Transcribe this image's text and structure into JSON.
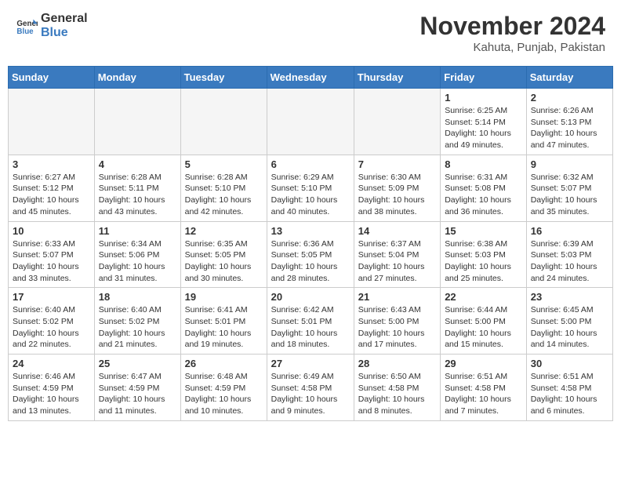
{
  "header": {
    "logo_line1": "General",
    "logo_line2": "Blue",
    "month_title": "November 2024",
    "location": "Kahuta, Punjab, Pakistan"
  },
  "days_of_week": [
    "Sunday",
    "Monday",
    "Tuesday",
    "Wednesday",
    "Thursday",
    "Friday",
    "Saturday"
  ],
  "weeks": [
    [
      {
        "day": "",
        "info": ""
      },
      {
        "day": "",
        "info": ""
      },
      {
        "day": "",
        "info": ""
      },
      {
        "day": "",
        "info": ""
      },
      {
        "day": "",
        "info": ""
      },
      {
        "day": "1",
        "info": "Sunrise: 6:25 AM\nSunset: 5:14 PM\nDaylight: 10 hours and 49 minutes."
      },
      {
        "day": "2",
        "info": "Sunrise: 6:26 AM\nSunset: 5:13 PM\nDaylight: 10 hours and 47 minutes."
      }
    ],
    [
      {
        "day": "3",
        "info": "Sunrise: 6:27 AM\nSunset: 5:12 PM\nDaylight: 10 hours and 45 minutes."
      },
      {
        "day": "4",
        "info": "Sunrise: 6:28 AM\nSunset: 5:11 PM\nDaylight: 10 hours and 43 minutes."
      },
      {
        "day": "5",
        "info": "Sunrise: 6:28 AM\nSunset: 5:10 PM\nDaylight: 10 hours and 42 minutes."
      },
      {
        "day": "6",
        "info": "Sunrise: 6:29 AM\nSunset: 5:10 PM\nDaylight: 10 hours and 40 minutes."
      },
      {
        "day": "7",
        "info": "Sunrise: 6:30 AM\nSunset: 5:09 PM\nDaylight: 10 hours and 38 minutes."
      },
      {
        "day": "8",
        "info": "Sunrise: 6:31 AM\nSunset: 5:08 PM\nDaylight: 10 hours and 36 minutes."
      },
      {
        "day": "9",
        "info": "Sunrise: 6:32 AM\nSunset: 5:07 PM\nDaylight: 10 hours and 35 minutes."
      }
    ],
    [
      {
        "day": "10",
        "info": "Sunrise: 6:33 AM\nSunset: 5:07 PM\nDaylight: 10 hours and 33 minutes."
      },
      {
        "day": "11",
        "info": "Sunrise: 6:34 AM\nSunset: 5:06 PM\nDaylight: 10 hours and 31 minutes."
      },
      {
        "day": "12",
        "info": "Sunrise: 6:35 AM\nSunset: 5:05 PM\nDaylight: 10 hours and 30 minutes."
      },
      {
        "day": "13",
        "info": "Sunrise: 6:36 AM\nSunset: 5:05 PM\nDaylight: 10 hours and 28 minutes."
      },
      {
        "day": "14",
        "info": "Sunrise: 6:37 AM\nSunset: 5:04 PM\nDaylight: 10 hours and 27 minutes."
      },
      {
        "day": "15",
        "info": "Sunrise: 6:38 AM\nSunset: 5:03 PM\nDaylight: 10 hours and 25 minutes."
      },
      {
        "day": "16",
        "info": "Sunrise: 6:39 AM\nSunset: 5:03 PM\nDaylight: 10 hours and 24 minutes."
      }
    ],
    [
      {
        "day": "17",
        "info": "Sunrise: 6:40 AM\nSunset: 5:02 PM\nDaylight: 10 hours and 22 minutes."
      },
      {
        "day": "18",
        "info": "Sunrise: 6:40 AM\nSunset: 5:02 PM\nDaylight: 10 hours and 21 minutes."
      },
      {
        "day": "19",
        "info": "Sunrise: 6:41 AM\nSunset: 5:01 PM\nDaylight: 10 hours and 19 minutes."
      },
      {
        "day": "20",
        "info": "Sunrise: 6:42 AM\nSunset: 5:01 PM\nDaylight: 10 hours and 18 minutes."
      },
      {
        "day": "21",
        "info": "Sunrise: 6:43 AM\nSunset: 5:00 PM\nDaylight: 10 hours and 17 minutes."
      },
      {
        "day": "22",
        "info": "Sunrise: 6:44 AM\nSunset: 5:00 PM\nDaylight: 10 hours and 15 minutes."
      },
      {
        "day": "23",
        "info": "Sunrise: 6:45 AM\nSunset: 5:00 PM\nDaylight: 10 hours and 14 minutes."
      }
    ],
    [
      {
        "day": "24",
        "info": "Sunrise: 6:46 AM\nSunset: 4:59 PM\nDaylight: 10 hours and 13 minutes."
      },
      {
        "day": "25",
        "info": "Sunrise: 6:47 AM\nSunset: 4:59 PM\nDaylight: 10 hours and 11 minutes."
      },
      {
        "day": "26",
        "info": "Sunrise: 6:48 AM\nSunset: 4:59 PM\nDaylight: 10 hours and 10 minutes."
      },
      {
        "day": "27",
        "info": "Sunrise: 6:49 AM\nSunset: 4:58 PM\nDaylight: 10 hours and 9 minutes."
      },
      {
        "day": "28",
        "info": "Sunrise: 6:50 AM\nSunset: 4:58 PM\nDaylight: 10 hours and 8 minutes."
      },
      {
        "day": "29",
        "info": "Sunrise: 6:51 AM\nSunset: 4:58 PM\nDaylight: 10 hours and 7 minutes."
      },
      {
        "day": "30",
        "info": "Sunrise: 6:51 AM\nSunset: 4:58 PM\nDaylight: 10 hours and 6 minutes."
      }
    ]
  ]
}
